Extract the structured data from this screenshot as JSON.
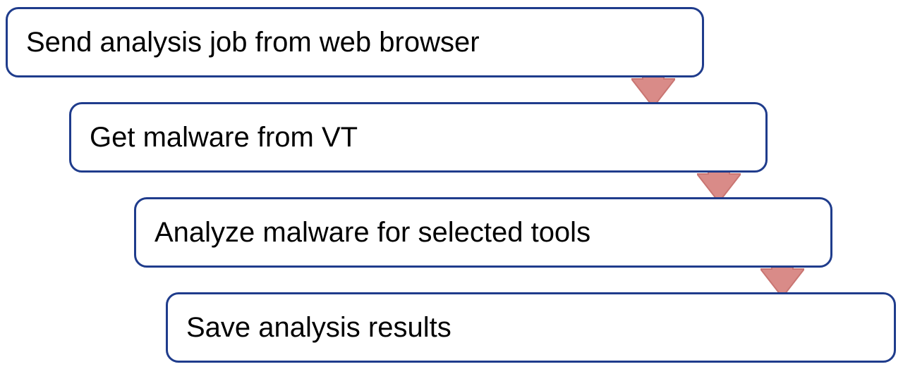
{
  "diagram": {
    "border_color": "#1F3C8C",
    "arrow_fill": "#D98B88",
    "arrow_stroke": "#C97572",
    "steps": [
      {
        "label": "Send analysis job from web browser"
      },
      {
        "label": "Get malware from VT"
      },
      {
        "label": "Analyze malware for selected tools"
      },
      {
        "label": "Save analysis results"
      }
    ]
  }
}
